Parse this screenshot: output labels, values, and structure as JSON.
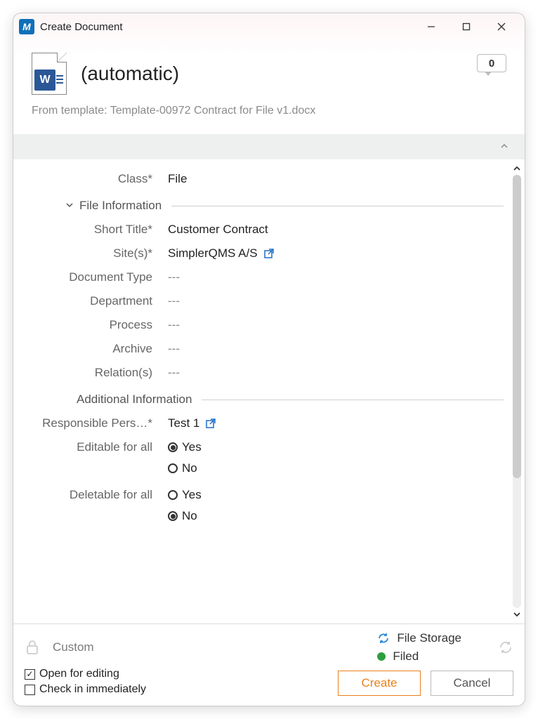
{
  "titlebar": {
    "app_initial": "M",
    "title": "Create Document"
  },
  "header": {
    "doc_initial": "W",
    "doc_name": "(automatic)",
    "comment_count": "0",
    "from_template_prefix": "From template: ",
    "from_template_name": "Template-00972 Contract for File v1.docx"
  },
  "form": {
    "class_label": "Class*",
    "class_value": "File",
    "section_file_info": "File Information",
    "short_title_label": "Short Title*",
    "short_title_value": "Customer Contract",
    "sites_label": "Site(s)*",
    "sites_value": "SimplerQMS A/S",
    "doc_type_label": "Document Type",
    "doc_type_value": "---",
    "department_label": "Department",
    "department_value": "---",
    "process_label": "Process",
    "process_value": "---",
    "archive_label": "Archive",
    "archive_value": "---",
    "relations_label": "Relation(s)",
    "relations_value": "---",
    "section_additional": "Additional Information",
    "responsible_label": "Responsible Pers…*",
    "responsible_value": "Test 1",
    "editable_label": "Editable for all",
    "deletable_label": "Deletable for all",
    "yes": "Yes",
    "no": "No"
  },
  "footer": {
    "custom_label": "Custom",
    "file_storage": "File Storage",
    "filed": "Filed",
    "open_for_editing": "Open for editing",
    "check_in_immediately": "Check in immediately",
    "create": "Create",
    "cancel": "Cancel"
  }
}
